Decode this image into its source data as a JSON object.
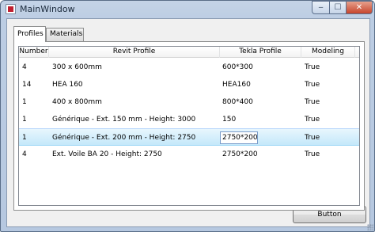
{
  "window": {
    "title": "MainWindow",
    "controls": {
      "minimize": "‒",
      "maximize": "☐",
      "close": "✕"
    }
  },
  "tabs": [
    {
      "label": "Profiles",
      "active": true
    },
    {
      "label": "Materials",
      "active": false
    }
  ],
  "grid": {
    "columns": [
      "Number",
      "Revit Profile",
      "Tekla Profile",
      "Modeling"
    ],
    "rows": [
      {
        "number": "4",
        "revit": "300 x 600mm",
        "tekla": "600*300",
        "modeling": "True"
      },
      {
        "number": "14",
        "revit": "HEA 160",
        "tekla": "HEA160",
        "modeling": "True"
      },
      {
        "number": "1",
        "revit": "400 x 800mm",
        "tekla": "800*400",
        "modeling": "True"
      },
      {
        "number": "1",
        "revit": "Générique - Ext. 150 mm - Height: 3000",
        "tekla": "150",
        "modeling": "True"
      },
      {
        "number": "1",
        "revit": "Générique - Ext. 200 mm - Height: 2750",
        "tekla": "2750*200",
        "modeling": "True",
        "selected": true,
        "editing": true
      },
      {
        "number": "4",
        "revit": "Ext. Voile BA 20 - Height: 2750",
        "tekla": "2750*200",
        "modeling": "True"
      }
    ]
  },
  "button": {
    "label": "Button"
  },
  "colors": {
    "selection": "#c4e8fa",
    "frame": "#bccde3",
    "client": "#f0f0f0"
  }
}
